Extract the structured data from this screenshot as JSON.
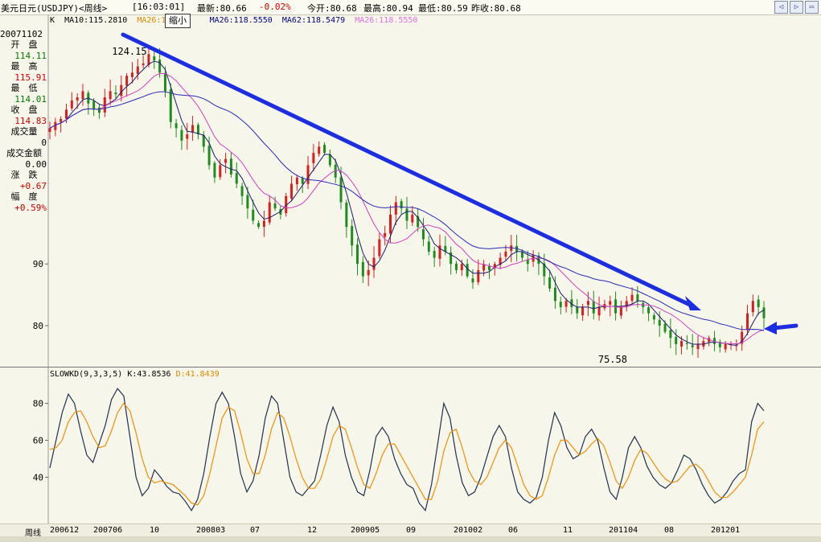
{
  "header": {
    "instrument": "美元日元(USDJPY)<周线>",
    "time": "[16:03:01]",
    "latest": "最新:80.66",
    "change": "-0.02%",
    "open": "今开:80.68",
    "high": "最高:80.94",
    "low": "最低:80.59",
    "prev_close": "昨收:80.68",
    "zoom_label": "缩小"
  },
  "legend": {
    "k": "K",
    "ma10": "MA10:115.2810",
    "ma26a": "MA26:11",
    "ma26b": "MA26:118.5550",
    "ma62": "MA62:118.5479",
    "ma26c": "MA26:118.5550"
  },
  "info": {
    "date": "20071102",
    "open_label": "开　盘",
    "open": "114.11",
    "high_label": "最　高",
    "high": "115.91",
    "low_label": "最　低",
    "low": "114.01",
    "close_label": "收　盘",
    "close": "114.83",
    "volume_label": "成交量",
    "volume": "0",
    "amount_label": "成交金额",
    "amount": "0.00",
    "change_label": "涨　跌",
    "change": "+0.67",
    "range_label": "幅　度",
    "range": "+0.59%"
  },
  "kd_legend": {
    "name": "SLOWKD(9,3,3,5)",
    "k": "K:43.8536",
    "d": "D:41.8439"
  },
  "xaxis": {
    "period": "周线",
    "ticks": [
      "200612",
      "200706",
      "10",
      "200803",
      "07",
      "12",
      "200905",
      "09",
      "201002",
      "06",
      "11",
      "201104",
      "08",
      "201201"
    ]
  },
  "colors": {
    "up": "#d81e1e",
    "down": "#1e8c1e",
    "ma_short": "#1a1a6e",
    "ma_mid": "#d040c0",
    "ma_long": "#2a2ab8",
    "trend_arrow": "#1c2ee0",
    "k_line": "#1f3050",
    "d_line": "#f0900a",
    "ma10_text": "#000000",
    "ma26a_text": "#e08a00",
    "ma26b_text": "#000080",
    "ma62_text": "#000080",
    "ma26c_text": "#e070e0"
  },
  "chart_data": [
    {
      "type": "candlestick",
      "yticks": [
        90,
        80
      ],
      "ylim": [
        74,
        126
      ],
      "annotations": [
        {
          "label": "124.15",
          "x": 23,
          "y": 124.15
        },
        {
          "label": "75.58",
          "x": 203,
          "y": 75.58
        }
      ],
      "close_series": [
        112,
        113,
        113.5,
        115,
        116.5,
        117,
        118,
        116,
        115,
        114.5,
        117,
        118,
        117.5,
        119,
        120.5,
        121,
        122,
        122.5,
        124,
        123,
        121,
        118,
        113,
        112,
        110,
        111,
        112.5,
        111,
        109,
        106,
        104,
        106,
        107,
        104.5,
        103,
        101,
        99,
        97,
        96,
        97,
        100,
        99,
        98,
        101,
        103,
        104,
        103,
        106,
        108,
        109,
        108,
        106,
        104,
        100,
        96,
        93,
        90,
        88,
        89,
        91,
        94,
        95,
        98,
        100,
        99,
        97,
        98,
        96,
        94,
        92,
        91,
        93,
        92,
        90,
        89,
        90,
        88,
        87,
        89,
        90,
        89,
        90,
        91,
        92,
        93,
        92,
        91,
        90,
        91.5,
        90,
        88,
        86,
        84,
        83,
        84,
        83,
        82,
        83,
        84,
        82,
        83,
        83.5,
        84,
        82,
        83,
        84,
        85,
        84,
        83,
        82,
        81,
        80,
        79,
        78,
        77,
        77.5,
        77,
        76.5,
        77,
        77.5,
        78,
        77,
        76.5,
        77,
        77,
        76.8,
        79,
        82,
        84,
        83,
        81.2
      ],
      "x_range": [
        0,
        230
      ]
    },
    {
      "type": "line",
      "title": "SLOWKD(9,3,3,5)",
      "yticks": [
        80,
        60,
        40
      ],
      "ylim": [
        18,
        92
      ],
      "series": [
        {
          "name": "K",
          "values": [
            45,
            60,
            75,
            85,
            80,
            65,
            52,
            48,
            58,
            68,
            82,
            88,
            84,
            62,
            40,
            30,
            34,
            44,
            40,
            35,
            32,
            31,
            27,
            22,
            28,
            42,
            62,
            80,
            86,
            80,
            62,
            42,
            32,
            38,
            52,
            72,
            84,
            80,
            60,
            40,
            32,
            30,
            34,
            38,
            52,
            68,
            78,
            70,
            52,
            40,
            32,
            30,
            44,
            62,
            67,
            62,
            50,
            42,
            36,
            34,
            26,
            22,
            36,
            58,
            80,
            72,
            52,
            37,
            30,
            32,
            40,
            51,
            62,
            68,
            62,
            45,
            32,
            28,
            26,
            29,
            40,
            60,
            75,
            68,
            56,
            50,
            52,
            62,
            66,
            60,
            45,
            32,
            28,
            40,
            56,
            62,
            56,
            46,
            40,
            36,
            34,
            37,
            44,
            52,
            50,
            44,
            36,
            30,
            26,
            28,
            32,
            38,
            42,
            44,
            70,
            80,
            76
          ]
        },
        {
          "name": "D",
          "values": [
            55,
            56,
            60,
            70,
            75,
            76,
            70,
            62,
            56,
            57,
            65,
            75,
            80,
            76,
            64,
            50,
            40,
            37,
            38,
            37,
            36,
            33,
            30,
            26,
            25,
            30,
            42,
            57,
            72,
            78,
            76,
            64,
            50,
            42,
            42,
            52,
            66,
            75,
            72,
            62,
            50,
            40,
            34,
            34,
            39,
            50,
            62,
            68,
            66,
            56,
            45,
            36,
            34,
            42,
            52,
            58,
            58,
            52,
            46,
            40,
            34,
            28,
            28,
            38,
            54,
            64,
            66,
            56,
            44,
            38,
            36,
            40,
            48,
            56,
            60,
            56,
            46,
            36,
            30,
            28,
            30,
            40,
            52,
            60,
            60,
            56,
            52,
            54,
            58,
            61,
            57,
            48,
            38,
            34,
            40,
            49,
            55,
            53,
            48,
            43,
            39,
            37,
            38,
            42,
            46,
            47,
            44,
            38,
            32,
            29,
            29,
            32,
            36,
            40,
            52,
            66,
            70
          ]
        }
      ]
    }
  ]
}
